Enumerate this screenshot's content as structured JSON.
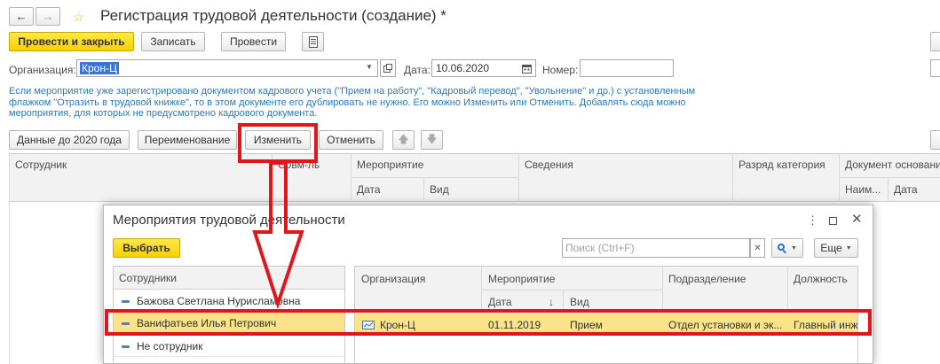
{
  "window": {
    "title": "Регистрация трудовой деятельности (создание) *",
    "nav_back": "←",
    "nav_forward": "→"
  },
  "toolbar": {
    "post_close": "Провести и закрыть",
    "save": "Записать",
    "post": "Провести"
  },
  "header_fields": {
    "org_label": "Организация:",
    "org_value": "Крон-Ц",
    "date_label": "Дата:",
    "date_value": "10.06.2020",
    "number_label": "Номер:",
    "number_value": ""
  },
  "info_text": "Если мероприятие уже зарегистрировано документом кадрового учета (\"Прием на работу\", \"Кадровый перевод\", \"Увольнение\" и др.) с установленным флажком \"Отразить в трудовой книжке\", то в этом документе его дублировать не нужно. Его можно Изменить или Отменить. Добавлять сюда можно мероприятия, для которых не предусмотрено кадрового документа.",
  "action_bar": {
    "data_before_2020": "Данные до 2020 года",
    "rename": "Переименование",
    "change": "Изменить",
    "cancel": "Отменить"
  },
  "main_table": {
    "col_employee": "Сотрудник",
    "col_parttime": "Совм-ль",
    "col_event": "Мероприятие",
    "col_event_date": "Дата",
    "col_event_kind": "Вид",
    "col_details": "Сведения",
    "col_rank": "Разряд категория",
    "col_basis": "Документ основание",
    "col_basis_name": "Наим...",
    "col_basis_date": "Дата"
  },
  "modal": {
    "title": "Мероприятия трудовой деятельности",
    "select_button": "Выбрать",
    "search_placeholder": "Поиск (Ctrl+F)",
    "more_button": "Еще",
    "employees_header": "Сотрудники",
    "employees": [
      "Бажова Светлана Нурисламовна",
      "Ванифатьев Илья Петрович",
      "Не сотрудник"
    ],
    "grid": {
      "col_org": "Организация",
      "col_event": "Мероприятие",
      "col_date": "Дата",
      "col_kind": "Вид",
      "col_dept": "Подразделение",
      "col_position": "Должность",
      "sort_arrow": "↓",
      "rows": [
        {
          "org": "Крон-Ц",
          "date": "01.11.2019",
          "kind": "Прием",
          "dept": "Отдел установки и эк...",
          "position": "Главный инже"
        }
      ]
    }
  },
  "colors": {
    "accent_yellow": "#f6d000",
    "selection_yellow": "#fbe38a",
    "info_blue": "#2a7ac2",
    "annotation_red": "#e0161b"
  }
}
